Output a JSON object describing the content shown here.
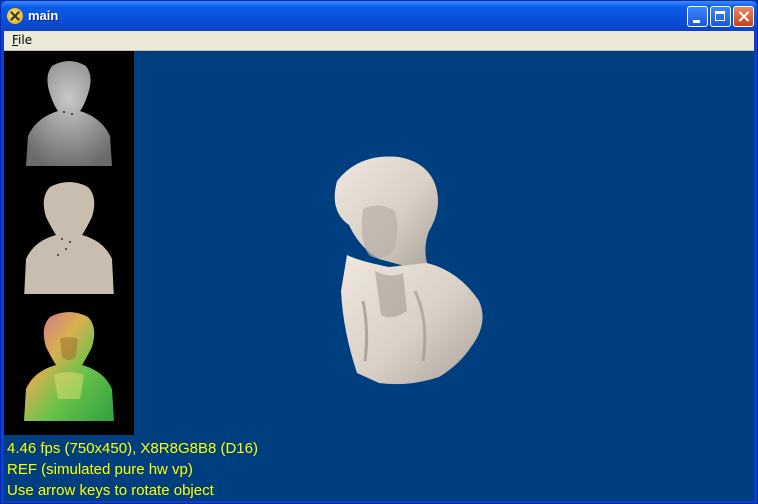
{
  "window": {
    "title": "main"
  },
  "menu": {
    "file_label": "File",
    "file_mnemonic": "F",
    "file_rest": "ile"
  },
  "sidebar": {
    "thumbnails": [
      {
        "name": "depth-preview",
        "color": "#9a9a9a"
      },
      {
        "name": "diffuse-preview",
        "color": "#c8bcb0"
      },
      {
        "name": "normal-preview",
        "color": "#5fb04a"
      }
    ]
  },
  "viewport": {
    "background": "#003f7f",
    "model": "bust"
  },
  "status": {
    "line1": "4.46 fps (750x450), X8R8G8B8 (D16)",
    "line2": "REF (simulated pure hw vp)",
    "line3": "Use arrow keys to rotate object"
  },
  "colors": {
    "status_text": "#ffff00",
    "titlebar": "#0a4fd9"
  }
}
